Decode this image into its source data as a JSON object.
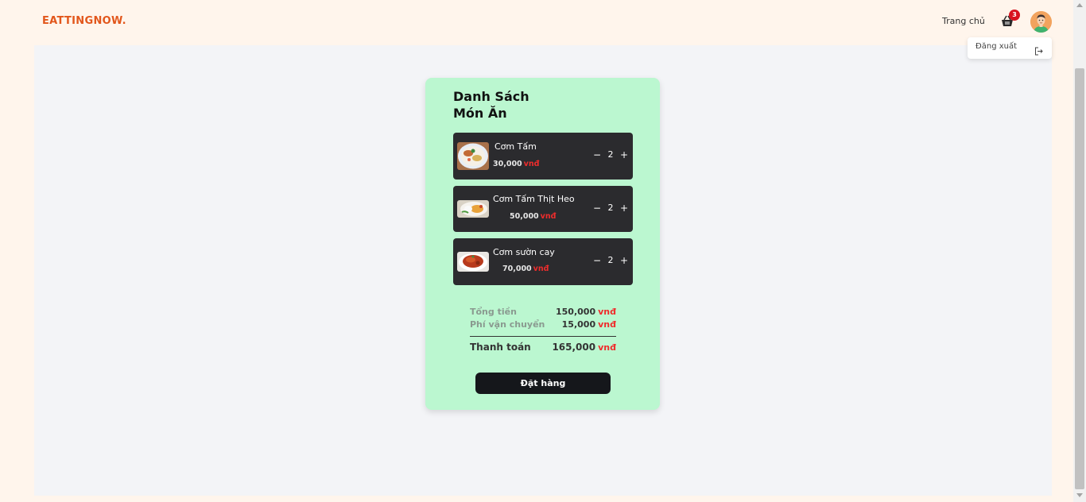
{
  "header": {
    "logo": "EATTINGNOW.",
    "nav_home": "Trang chủ",
    "cart_count": "3",
    "cart_icon": "shopping-basket-icon",
    "avatar_icon": "user-avatar"
  },
  "dropdown": {
    "logout_label": "Đăng xuất",
    "logout_icon": "logout-icon"
  },
  "cart": {
    "title_line1": "Danh Sách",
    "title_line2": "Món Ăn",
    "items": [
      {
        "name": "Cơm Tấm",
        "price": "30,000",
        "currency": "vnđ",
        "quantity": "2",
        "minus": "−",
        "plus": "+"
      },
      {
        "name": "Cơm Tấm Thịt Heo",
        "price": "50,000",
        "currency": "vnđ",
        "quantity": "2",
        "minus": "−",
        "plus": "+"
      },
      {
        "name": "Cơm sườn cay",
        "price": "70,000",
        "currency": "vnđ",
        "quantity": "2",
        "minus": "−",
        "plus": "+"
      }
    ],
    "subtotal_label": "Tổng tiền",
    "subtotal_value": "150,000",
    "shipping_label": "Phí vận chuyển",
    "shipping_value": "15,000",
    "total_label": "Thanh toán",
    "total_value": "165,000",
    "currency": "vnđ",
    "order_button": "Đặt hàng"
  },
  "colors": {
    "brand": "#e2571c",
    "card_bg": "#bbf7d0",
    "item_bg": "#2b2b2e",
    "currency": "#ef2c2c",
    "badge": "#d8121f",
    "button_bg": "#15171b"
  }
}
